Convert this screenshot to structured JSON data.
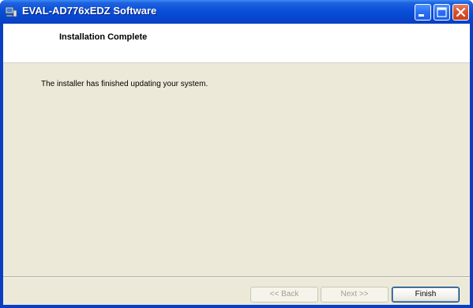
{
  "window": {
    "title": "EVAL-AD776xEDZ Software",
    "icons": {
      "app": "installer-app-icon",
      "minimize": "minimize-icon",
      "maximize": "maximize-icon",
      "close": "close-icon"
    }
  },
  "banner": {
    "title": "Installation Complete"
  },
  "body": {
    "message": "The installer has finished updating your system."
  },
  "buttons": {
    "back_label": "<< Back",
    "next_label": "Next >>",
    "finish_label": "Finish"
  },
  "colors": {
    "titlebar": "#0a4fd8",
    "close_button": "#d9502c",
    "dialog_face": "#ece9d8",
    "banner": "#ffffff"
  }
}
